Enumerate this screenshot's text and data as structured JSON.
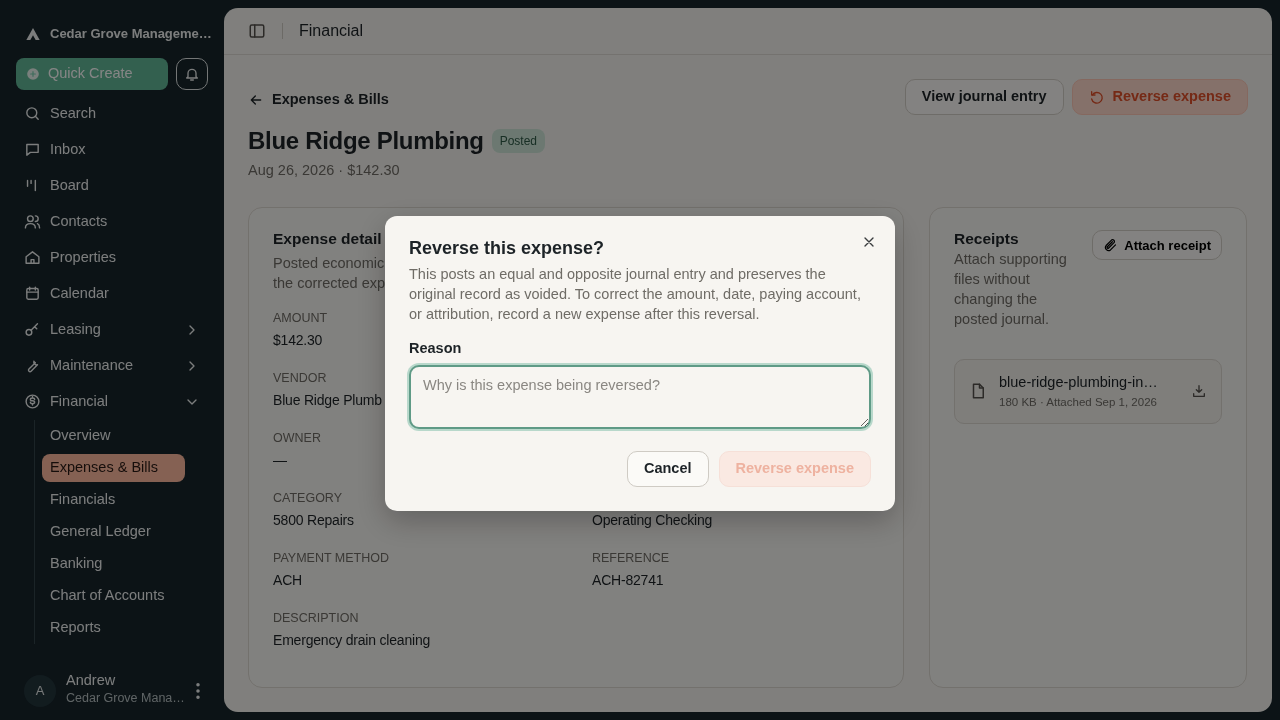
{
  "sidebar": {
    "org": "Cedar Grove Manageme…",
    "quick_create": "Quick Create",
    "items": [
      {
        "label": "Search",
        "kind": "link"
      },
      {
        "label": "Inbox",
        "kind": "link"
      },
      {
        "label": "Board",
        "kind": "link"
      },
      {
        "label": "Contacts",
        "kind": "link"
      },
      {
        "label": "Properties",
        "kind": "link"
      },
      {
        "label": "Calendar",
        "kind": "link"
      },
      {
        "label": "Leasing",
        "kind": "group",
        "expanded": false
      },
      {
        "label": "Maintenance",
        "kind": "group",
        "expanded": false
      },
      {
        "label": "Financial",
        "kind": "group",
        "expanded": true,
        "children": [
          {
            "label": "Overview",
            "selected": false
          },
          {
            "label": "Expenses & Bills",
            "selected": true
          },
          {
            "label": "Financials",
            "selected": false
          },
          {
            "label": "General Ledger",
            "selected": false
          },
          {
            "label": "Banking",
            "selected": false
          },
          {
            "label": "Chart of Accounts",
            "selected": false
          },
          {
            "label": "Reports",
            "selected": false
          }
        ]
      }
    ],
    "user": {
      "initial": "A",
      "name": "Andrew",
      "org": "Cedar Grove Mana…"
    }
  },
  "header": {
    "title": "Financial"
  },
  "page": {
    "back": "Expenses & Bills",
    "title": "Blue Ridge Plumbing",
    "status": "Posted",
    "subtitle": "Aug 26, 2026 · $142.30",
    "actions": [
      {
        "label": "View journal entry",
        "kind": "secondary"
      },
      {
        "label": "Reverse expense",
        "kind": "danger"
      }
    ]
  },
  "details": {
    "title": "Expense detail",
    "description_lines": [
      "Posted economic",
      "the corrected exp"
    ],
    "rows": [
      {
        "left": {
          "label": "AMOUNT",
          "value": "$142.30"
        }
      },
      {
        "left": {
          "label": "VENDOR",
          "value": "Blue Ridge Plumb"
        }
      },
      {
        "left": {
          "label": "OWNER",
          "value": "—"
        }
      },
      {
        "left": {
          "label": "CATEGORY",
          "value": "5800 Repairs"
        },
        "right": {
          "value": "Operating Checking"
        }
      },
      {
        "left": {
          "label": "PAYMENT METHOD",
          "value": "ACH"
        },
        "right": {
          "label": "REFERENCE",
          "value": "ACH-82741"
        }
      },
      {
        "left": {
          "label": "DESCRIPTION",
          "value": "Emergency drain cleaning"
        }
      }
    ]
  },
  "receipts": {
    "title": "Receipts",
    "description": "Attach supporting files without changing the posted journal.",
    "button": "Attach receipt",
    "files": [
      {
        "name": "blue-ridge-plumbing-in…",
        "meta": "180 KB · Attached Sep 1, 2026"
      }
    ]
  },
  "dialog": {
    "title": "Reverse this expense?",
    "body": "This posts an equal and opposite journal entry and preserves the original record as voided. To correct the amount, date, paying account, or attribution, record a new expense after this reversal.",
    "field_label": "Reason",
    "placeholder": "Why is this expense being reversed?",
    "buttons": [
      {
        "label": "Cancel",
        "kind": "secondary",
        "disabled": false
      },
      {
        "label": "Reverse expense",
        "kind": "danger",
        "disabled": true
      }
    ]
  }
}
